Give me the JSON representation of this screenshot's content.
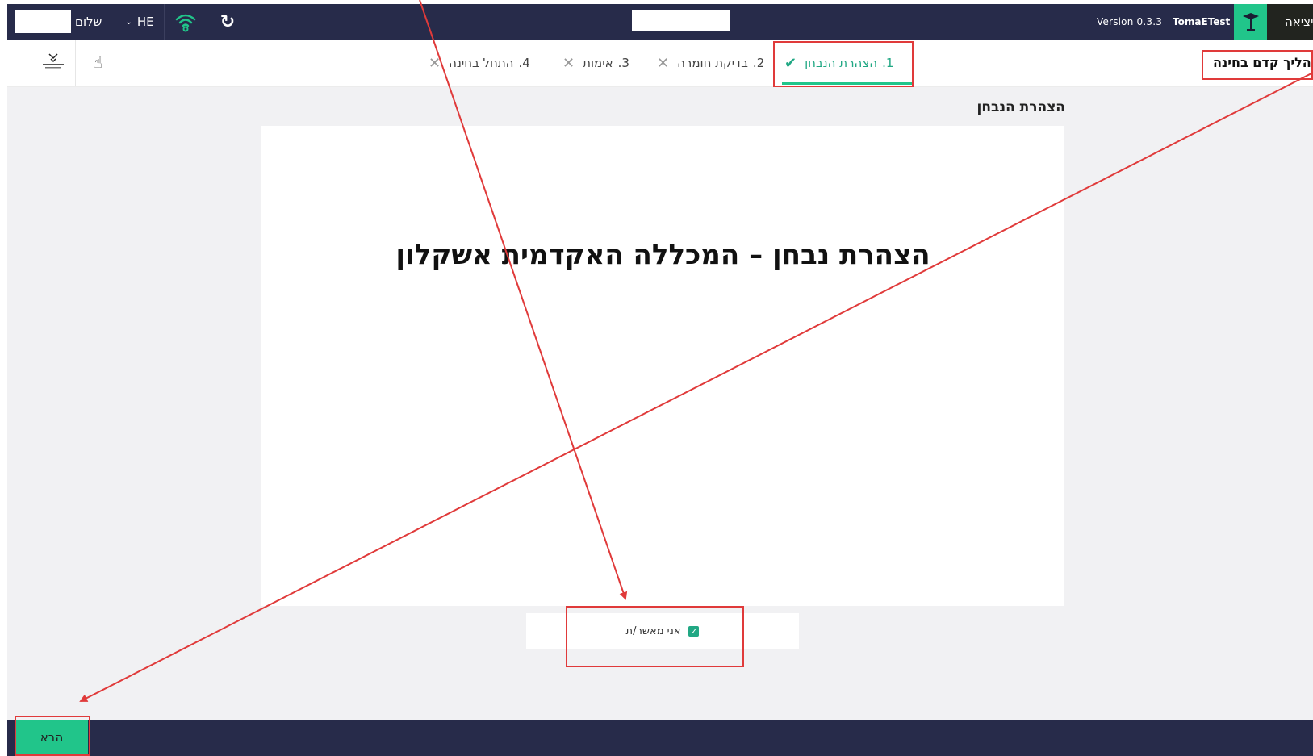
{
  "header": {
    "greeting": "שלום",
    "language": "HE",
    "version": "Version 0.3.3",
    "user": "TomaETest",
    "exit_label": "יציאה"
  },
  "steps": [
    {
      "num": "1.",
      "label": "הצהרת הנבחן",
      "status": "check"
    },
    {
      "num": "2.",
      "label": "בדיקת חומרה",
      "status": "x"
    },
    {
      "num": "3.",
      "label": "אימות",
      "status": "x"
    },
    {
      "num": "4.",
      "label": "התחל בחינה",
      "status": "x"
    }
  ],
  "process_title": "תהליך קדם בחינה",
  "section_title": "הצהרת הנבחן",
  "card_heading": "הצהרת נבחן – המכללה האקדמית אשקלון",
  "approve": {
    "label": "אני מאשר/ת",
    "checked": true
  },
  "footer": {
    "next_label": "הבא"
  },
  "colors": {
    "navy": "#272b4a",
    "accent": "#21c58a",
    "annotation": "#e03a3a"
  },
  "icons": [
    "wifi-icon",
    "refresh-icon",
    "chevron-down-icon",
    "graduation-logo-icon",
    "university-logo-icon",
    "hand-pointer-icon",
    "check-icon",
    "x-icon",
    "checkbox-checked-icon"
  ]
}
